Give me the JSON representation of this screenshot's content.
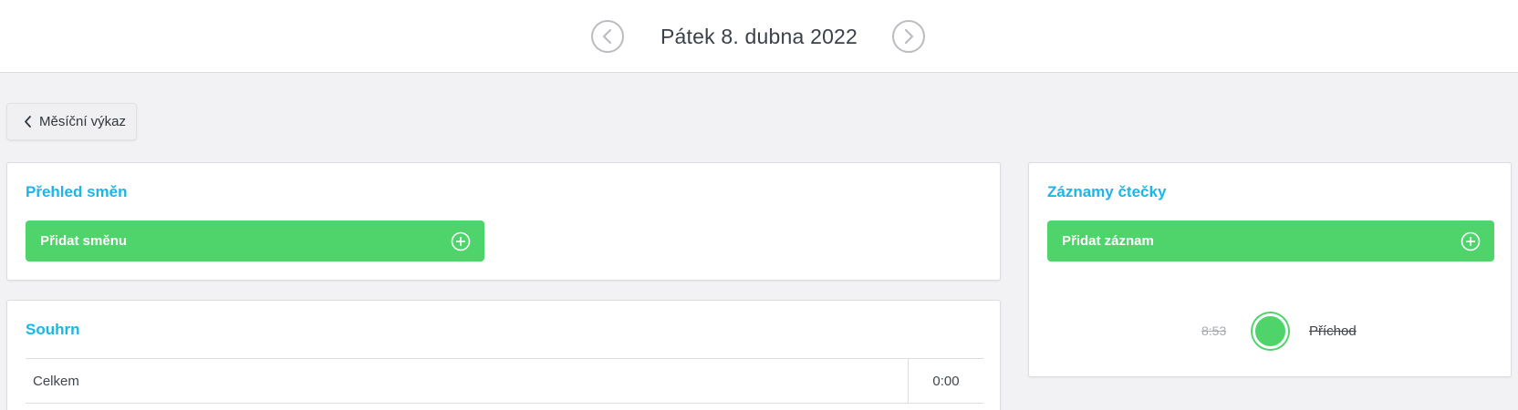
{
  "header": {
    "date_title": "Pátek 8. dubna 2022",
    "prev_icon": "chevron-left-circle-icon",
    "next_icon": "chevron-right-circle-icon"
  },
  "back_button": {
    "label": "Měsíční výkaz",
    "icon": "chevron-left-icon"
  },
  "shifts": {
    "title": "Přehled směn",
    "add_label": "Přidat směnu",
    "add_icon": "plus-circle-icon"
  },
  "reader": {
    "title": "Záznamy čtečky",
    "add_label": "Přidat záznam",
    "add_icon": "plus-circle-icon",
    "records": [
      {
        "time": "8:53",
        "type": "Příchod",
        "status_color": "#4fd46c"
      }
    ]
  },
  "summary": {
    "title": "Souhrn",
    "rows": [
      {
        "label": "Celkem",
        "value": "0:00"
      }
    ]
  },
  "colors": {
    "accent": "#1ab6e6",
    "green": "#4fd46c",
    "background": "#f2f2f4"
  }
}
